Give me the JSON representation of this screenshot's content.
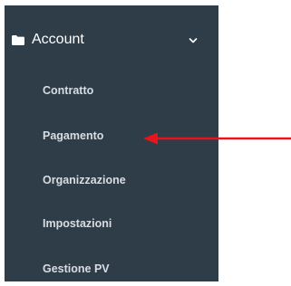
{
  "sidebar": {
    "section": {
      "label": "Account",
      "icon": "folder-icon",
      "expanded": true
    },
    "items": [
      {
        "label": "Contratto"
      },
      {
        "label": "Pagamento"
      },
      {
        "label": "Organizzazione"
      },
      {
        "label": "Impostazioni"
      },
      {
        "label": "Gestione PV"
      }
    ]
  },
  "colors": {
    "sidebar_bg": "#2f3d49",
    "item_text": "#d7dde3",
    "header_text": "#ffffff",
    "annotation_arrow": "#e8141c"
  }
}
